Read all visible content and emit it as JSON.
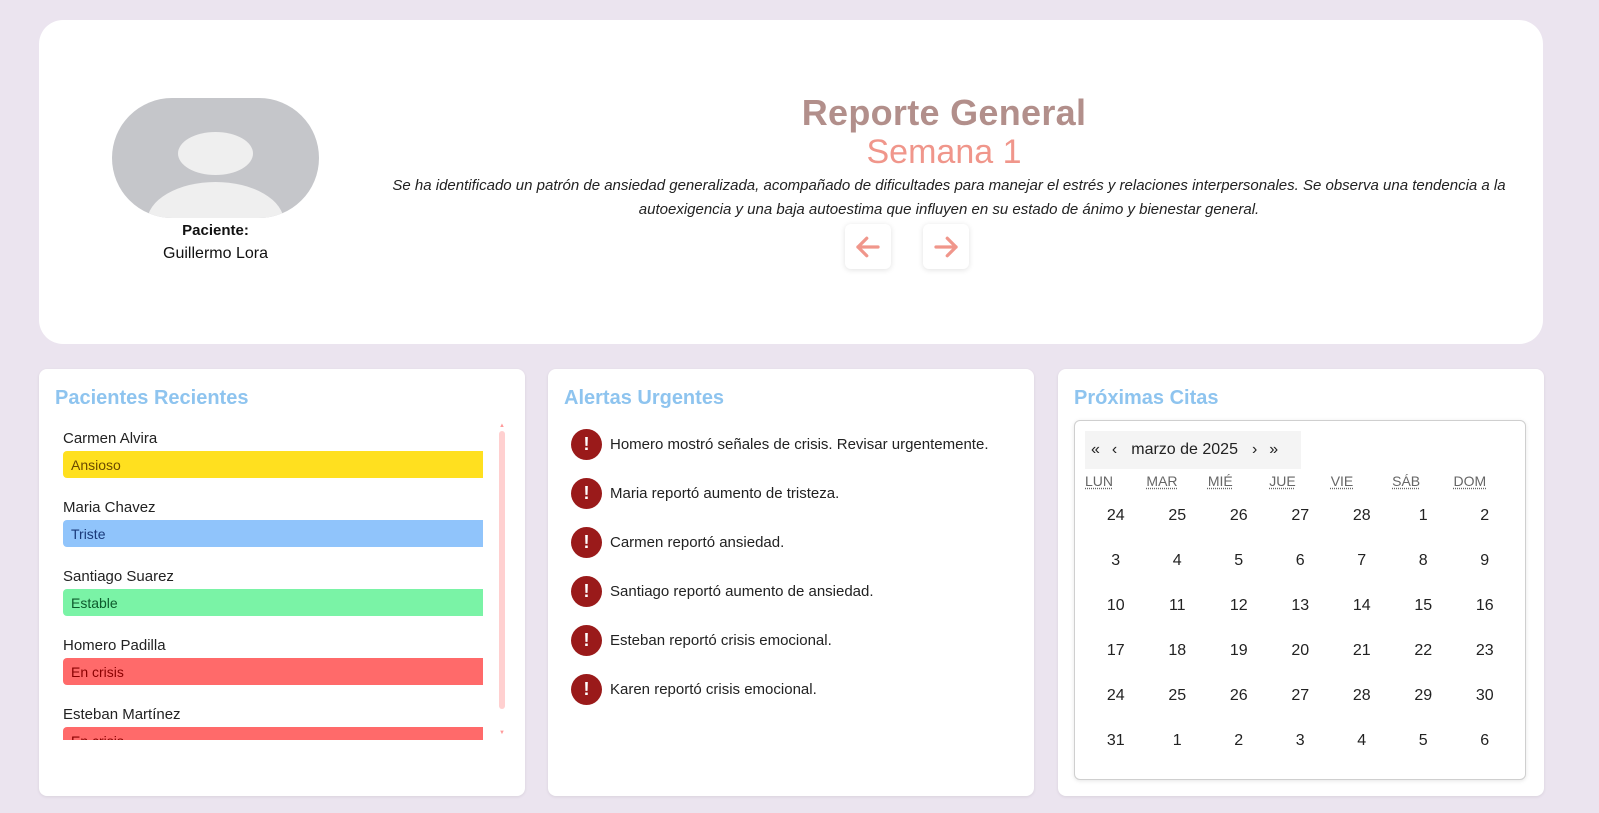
{
  "report": {
    "patient_label": "Paciente:",
    "patient_name": "Guillermo Lora",
    "title": "Reporte General",
    "week": "Semana 1",
    "summary": "Se ha identificado un patrón de ansiedad generalizada, acompañado de dificultades para manejar el estrés y relaciones interpersonales. Se observa una tendencia a la autoexigencia y una baja autoestima que influyen en su estado de ánimo y bienestar general.",
    "prev_icon": "arrow-left-icon",
    "next_icon": "arrow-right-icon",
    "accent_color": "#f0968b"
  },
  "recent_patients": {
    "title": "Pacientes Recientes",
    "items": [
      {
        "name": "Carmen Alvira",
        "state": "Ansioso",
        "color": "#ffe01f",
        "text_color": "#6b4a00"
      },
      {
        "name": "Maria Chavez",
        "state": "Triste",
        "color": "#90c4fb",
        "text_color": "#1a3a7a"
      },
      {
        "name": "Santiago Suarez",
        "state": "Estable",
        "color": "#7af3a6",
        "text_color": "#0d5a2c"
      },
      {
        "name": "Homero Padilla",
        "state": "En crisis",
        "color": "#ff6a6a",
        "text_color": "#8a0000"
      },
      {
        "name": "Esteban Martínez",
        "state": "En crisis",
        "color": "#ff6a6a",
        "text_color": "#8a0000"
      }
    ]
  },
  "alerts": {
    "title": "Alertas Urgentes",
    "items": [
      "Homero mostró señales de crisis. Revisar urgentemente.",
      "Maria reportó aumento de tristeza.",
      "Carmen reportó ansiedad.",
      "Santiago reportó aumento de ansiedad.",
      "Esteban reportó crisis emocional.",
      "Karen reportó crisis emocional."
    ]
  },
  "appointments": {
    "title": "Próximas Citas",
    "calendar": {
      "prev_year": "«",
      "prev_month": "‹",
      "month_label": "marzo de 2025",
      "next_month": "›",
      "next_year": "»",
      "weekdays": [
        "LUN",
        "MAR",
        "MIÉ",
        "JUE",
        "VIE",
        "SÁB",
        "DOM"
      ],
      "days": [
        "24",
        "25",
        "26",
        "27",
        "28",
        "1",
        "2",
        "3",
        "4",
        "5",
        "6",
        "7",
        "8",
        "9",
        "10",
        "11",
        "12",
        "13",
        "14",
        "15",
        "16",
        "17",
        "18",
        "19",
        "20",
        "21",
        "22",
        "23",
        "24",
        "25",
        "26",
        "27",
        "28",
        "29",
        "30",
        "31",
        "1",
        "2",
        "3",
        "4",
        "5",
        "6"
      ]
    }
  }
}
